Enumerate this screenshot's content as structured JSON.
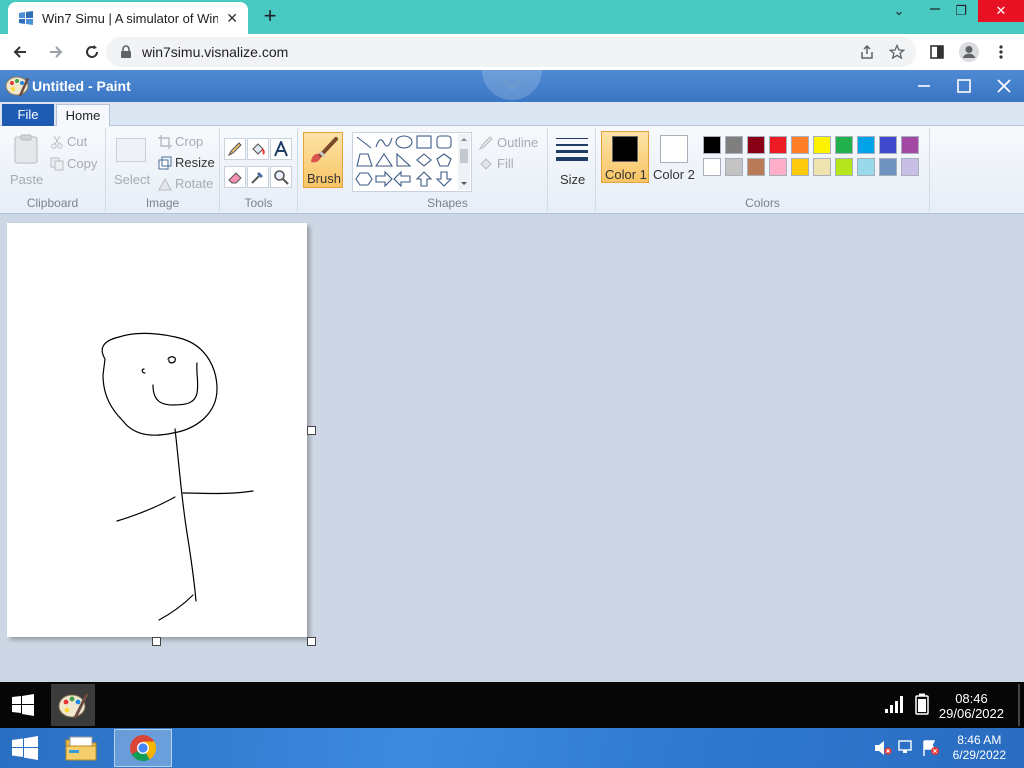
{
  "browser": {
    "tab_title": "Win7 Simu | A simulator of Wind",
    "tab_close": "✕",
    "new_tab": "+",
    "url": "win7simu.visnalize.com",
    "window_controls": {
      "chevron": "⌄",
      "restore": "❐",
      "close": "✕"
    }
  },
  "paint": {
    "title": "Untitled - Paint",
    "menu": {
      "file": "File",
      "home": "Home"
    },
    "ribbon": {
      "clipboard": {
        "paste": "Paste",
        "cut": "Cut",
        "copy": "Copy",
        "label": "Clipboard"
      },
      "image": {
        "select": "Select",
        "crop": "Crop",
        "resize": "Resize",
        "rotate": "Rotate",
        "label": "Image"
      },
      "tools": {
        "label": "Tools"
      },
      "brush": {
        "label": "Brush"
      },
      "shapes": {
        "outline": "Outline",
        "fill": "Fill",
        "label": "Shapes"
      },
      "size": {
        "label": "Size"
      },
      "colors": {
        "color1": "Color 1",
        "color2": "Color 2",
        "label": "Colors",
        "palette_row1": [
          "#000000",
          "#7f7f7f",
          "#880015",
          "#ed1c24",
          "#ff7f27",
          "#fff200",
          "#22b14c",
          "#00a2e8",
          "#3f48cc",
          "#a349a4"
        ],
        "palette_row2": [
          "#ffffff",
          "#c3c3c3",
          "#b97a57",
          "#ffaec9",
          "#ffc90e",
          "#efe4b0",
          "#b5e61d",
          "#99d9ea",
          "#7092be",
          "#c8bfe7"
        ]
      }
    }
  },
  "taskbar": {
    "time": "08:46",
    "date": "29/06/2022"
  },
  "host_taskbar": {
    "time": "8:46 AM",
    "date": "6/29/2022"
  }
}
